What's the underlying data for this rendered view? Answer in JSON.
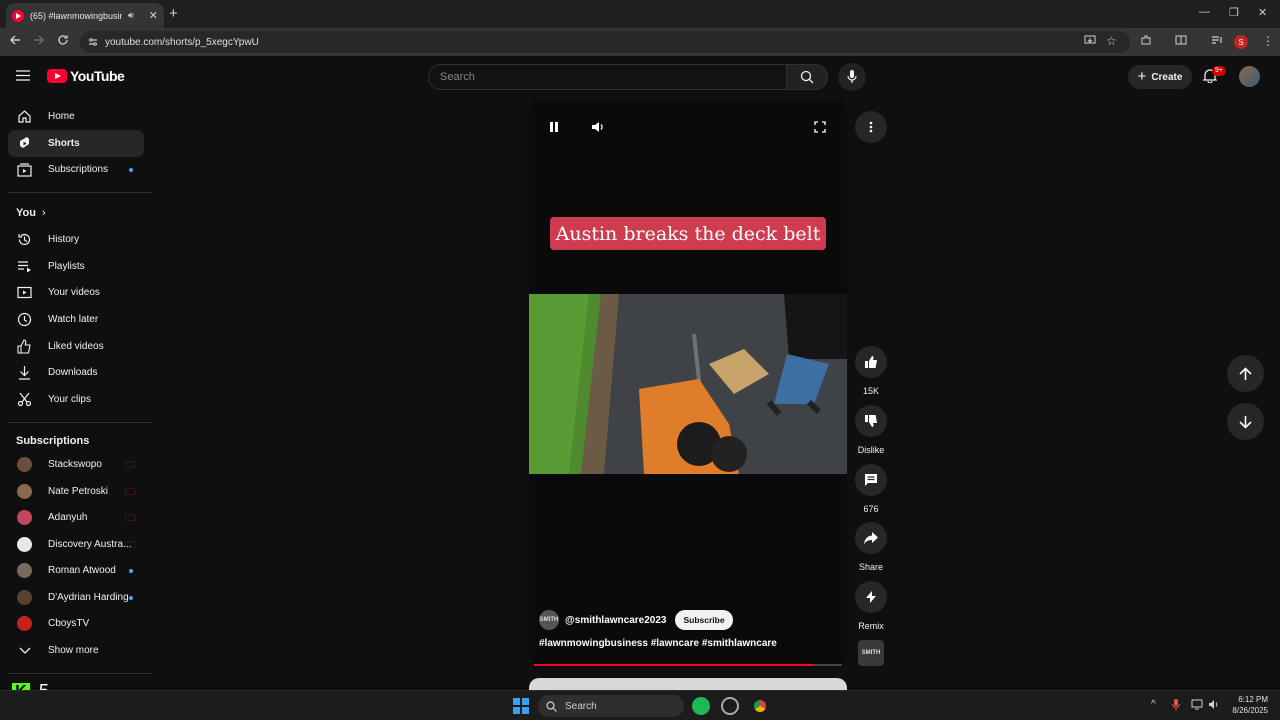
{
  "browser": {
    "tab_title": "(65) #lawnmowingbusiness",
    "url": "youtube.com/shorts/p_5xegcYpwU",
    "profile_initial": "S"
  },
  "header": {
    "logo": "YouTube",
    "search_placeholder": "Search",
    "create_label": "Create",
    "notification_badge": "9+"
  },
  "sidebar": {
    "main": [
      {
        "label": "Home"
      },
      {
        "label": "Shorts"
      },
      {
        "label": "Subscriptions"
      }
    ],
    "you_heading": "You",
    "you_items": [
      {
        "label": "History"
      },
      {
        "label": "Playlists"
      },
      {
        "label": "Your videos"
      },
      {
        "label": "Watch later"
      },
      {
        "label": "Liked videos"
      },
      {
        "label": "Downloads"
      },
      {
        "label": "Your clips"
      }
    ],
    "subs_heading": "Subscriptions",
    "subscriptions": [
      {
        "label": "Stackswopo",
        "color": "#6b4e3d"
      },
      {
        "label": "Nate Petroski",
        "color": "#8a6a4b"
      },
      {
        "label": "Adanyuh",
        "color": "#c0485a"
      },
      {
        "label": "Discovery Austra...",
        "color": "#e8e8e8"
      },
      {
        "label": "Roman Atwood",
        "color": "#7a6a5a"
      },
      {
        "label": "D'Aydrian Harding",
        "color": "#5a4030"
      },
      {
        "label": "CboysTV",
        "color": "#c5221f"
      }
    ],
    "show_more": "Show more"
  },
  "player": {
    "caption": "Austin breaks the deck belt",
    "channel": "@smithlawncare2023",
    "channel_avatar_text": "SMITH",
    "subscribe": "Subscribe",
    "hashtags": "#lawnmowingbusiness #lawncare #smithlawncare",
    "progress": 0.91
  },
  "actions": {
    "likes": "15K",
    "dislike": "Dislike",
    "comments": "676",
    "share": "Share",
    "remix": "Remix"
  },
  "overlay": {
    "counter": "5"
  },
  "taskbar": {
    "search": "Search",
    "time": "6:12 PM",
    "date": "8/26/2025"
  },
  "colors": {
    "brand_red": "#ff0033",
    "caption_bg": "#cf3c4f",
    "accent_blue": "#3ea6ff"
  }
}
